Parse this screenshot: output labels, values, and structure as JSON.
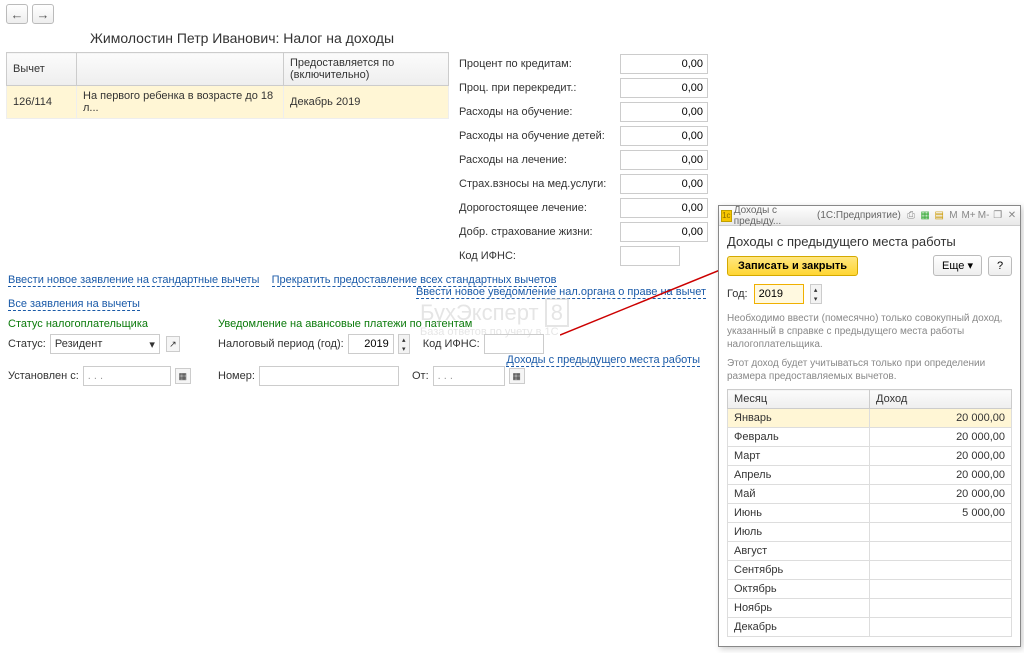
{
  "nav": {
    "back": "←",
    "forward": "→"
  },
  "page_title": "Жимолостин Петр Иванович: Налог на доходы",
  "ded_table": {
    "th_code": "Вычет",
    "th_desc": "",
    "th_until": "Предоставляется по (включительно)",
    "row": {
      "code": "126/114",
      "desc": "На первого ребенка в возрасте до 18 л...",
      "until": "Декабрь 2019"
    }
  },
  "right_fields": {
    "f1_label": "Процент по кредитам:",
    "f1_val": "0,00",
    "f2_label": "Проц. при перекредит.:",
    "f2_val": "0,00",
    "f3_label": "Расходы на обучение:",
    "f3_val": "0,00",
    "f4_label": "Расходы на обучение детей:",
    "f4_val": "0,00",
    "f5_label": "Расходы на лечение:",
    "f5_val": "0,00",
    "f6_label": "Страх.взносы на мед.услуги:",
    "f6_val": "0,00",
    "f7_label": "Дорогостоящее лечение:",
    "f7_val": "0,00",
    "f8_label": "Добр. страхование жизни:",
    "f8_val": "0,00",
    "f9_label": "Код ИФНС:",
    "f9_val": ""
  },
  "links": {
    "new_std": "Ввести новое заявление на стандартные вычеты",
    "stop_std": "Прекратить предоставление всех стандартных вычетов",
    "new_notice": "Ввести новое уведомление нал.органа о праве на вычет",
    "all_req": "Все заявления на вычеты",
    "prev_income": "Доходы с предыдущего места работы"
  },
  "sections": {
    "status": "Статус налогоплательщика",
    "patent": "Уведомление на авансовые платежи по патентам"
  },
  "status_area": {
    "lbl": "Статус:",
    "val": "Резидент",
    "set_lbl": "Установлен с:",
    "set_val": ". . ."
  },
  "patent_area": {
    "period_lbl": "Налоговый период (год):",
    "period_val": "2019",
    "ifns_lbl": "Код ИФНС:",
    "num_lbl": "Номер:",
    "from_lbl": "От:",
    "from_val": ". . ."
  },
  "popup": {
    "tb_title": "Доходы с предыду...",
    "tb_app": "(1С:Предприятие)",
    "title": "Доходы с предыдущего места работы",
    "save_btn": "Записать и закрыть",
    "more_btn": "Еще",
    "help_btn": "?",
    "year_lbl": "Год:",
    "year_val": "2019",
    "hint1": "Необходимо ввести (помесячно) только совокупный доход, указанный в справке с предыдущего места работы налогоплательщика.",
    "hint2": "Этот доход будет учитываться только при определении размера предоставляемых вычетов.",
    "th_month": "Месяц",
    "th_income": "Доход",
    "rows": [
      {
        "m": "Январь",
        "v": "20 000,00"
      },
      {
        "m": "Февраль",
        "v": "20 000,00"
      },
      {
        "m": "Март",
        "v": "20 000,00"
      },
      {
        "m": "Апрель",
        "v": "20 000,00"
      },
      {
        "m": "Май",
        "v": "20 000,00"
      },
      {
        "m": "Июнь",
        "v": "5 000,00"
      },
      {
        "m": "Июль",
        "v": ""
      },
      {
        "m": "Август",
        "v": ""
      },
      {
        "m": "Сентябрь",
        "v": ""
      },
      {
        "m": "Октябрь",
        "v": ""
      },
      {
        "m": "Ноябрь",
        "v": ""
      },
      {
        "m": "Декабрь",
        "v": ""
      }
    ]
  },
  "watermark": {
    "title": "БухЭксперт",
    "sub": "База ответов по учету в 1С",
    "badge": "8"
  }
}
